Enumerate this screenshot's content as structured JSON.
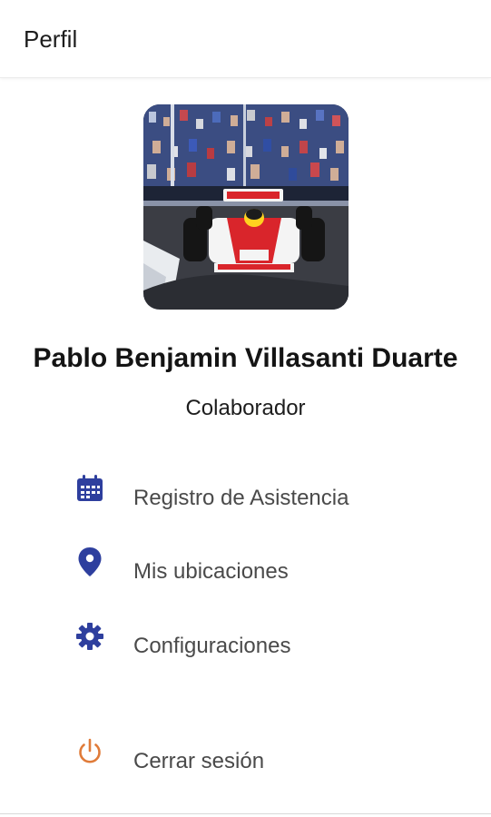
{
  "header": {
    "title": "Perfil"
  },
  "profile": {
    "name": "Pablo Benjamin Villasanti Duarte",
    "role": "Colaborador"
  },
  "menu": [
    {
      "label": "Registro de Asistencia",
      "icon": "calendar-icon",
      "color": "#2e3f9e"
    },
    {
      "label": "Mis ubicaciones",
      "icon": "location-pin-icon",
      "color": "#2e3f9e"
    },
    {
      "label": "Configuraciones",
      "icon": "gear-icon",
      "color": "#2e3f9e"
    },
    {
      "label": "Cerrar sesión",
      "icon": "power-icon",
      "color": "#e07b39"
    }
  ],
  "colors": {
    "accent": "#2e3f9e",
    "logout": "#e07b39"
  }
}
